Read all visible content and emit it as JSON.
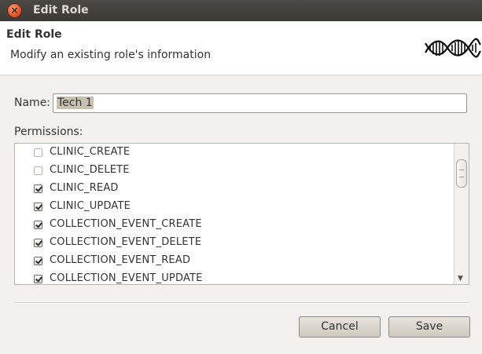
{
  "window": {
    "title": "Edit Role"
  },
  "header": {
    "title": "Edit Role",
    "description": "Modify an existing role's information"
  },
  "form": {
    "name_label": "Name:",
    "name_value": "Tech 1",
    "permissions_label": "Permissions:",
    "permissions": [
      {
        "label": "CLINIC_CREATE",
        "checked": false
      },
      {
        "label": "CLINIC_DELETE",
        "checked": false
      },
      {
        "label": "CLINIC_READ",
        "checked": true
      },
      {
        "label": "CLINIC_UPDATE",
        "checked": true
      },
      {
        "label": "COLLECTION_EVENT_CREATE",
        "checked": true
      },
      {
        "label": "COLLECTION_EVENT_DELETE",
        "checked": true
      },
      {
        "label": "COLLECTION_EVENT_READ",
        "checked": true
      },
      {
        "label": "COLLECTION_EVENT_UPDATE",
        "checked": true
      }
    ]
  },
  "buttons": {
    "cancel": "Cancel",
    "save": "Save"
  },
  "icons": {
    "close": "close-icon",
    "logo": "dna-helix-icon",
    "scroll_down": "arrow-down-icon"
  }
}
